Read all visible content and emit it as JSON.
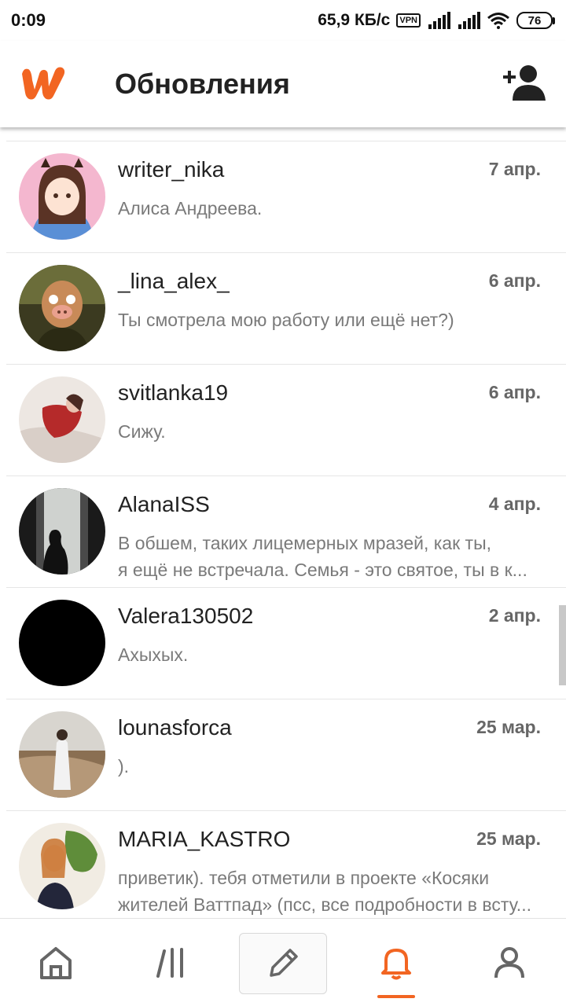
{
  "status_bar": {
    "time": "0:09",
    "network_speed": "65,9 КБ/с",
    "vpn": "VPN",
    "battery": "76"
  },
  "app_bar": {
    "title": "Обновления",
    "logo_icon": "wattpad-logo",
    "action_icon": "add-friend-icon"
  },
  "colors": {
    "accent": "#f26522",
    "text_primary": "#222222",
    "text_secondary": "#7a7a7a",
    "date_text": "#666666",
    "divider": "#e6e6e6"
  },
  "messages": [
    {
      "username": "writer_nika",
      "date": "7 апр.",
      "line1": "Алиса Андреева.",
      "line2": ""
    },
    {
      "username": "_lina_alex_",
      "date": "6 апр.",
      "line1": "Ты смотрела мою работу или ещё нет?)",
      "line2": ""
    },
    {
      "username": "svitlanka19",
      "date": "6 апр.",
      "line1": "Сижу.",
      "line2": ""
    },
    {
      "username": "AlanaISS",
      "date": "4 апр.",
      "line1": "В обшем, таких лицемерных мразей, как ты,",
      "line2": "я ещё не встречала. Семья - это святое, ты в к..."
    },
    {
      "username": "Valera130502",
      "date": "2 апр.",
      "line1": "Ахыхых.",
      "line2": ""
    },
    {
      "username": "lounasforca",
      "date": "25 мар.",
      "line1": ").",
      "line2": ""
    },
    {
      "username": "MARIA_KASTRO",
      "date": "25 мар.",
      "line1": "приветик). тебя отметили в проекте «Косяки",
      "line2": "жителей Ваттпад» (псс, все подробности в всту..."
    }
  ],
  "bottom_nav": [
    {
      "icon": "home-icon",
      "active": false
    },
    {
      "icon": "library-icon",
      "active": false
    },
    {
      "icon": "write-pencil-icon",
      "active": false
    },
    {
      "icon": "notifications-bell-icon",
      "active": true
    },
    {
      "icon": "profile-icon",
      "active": false
    }
  ]
}
